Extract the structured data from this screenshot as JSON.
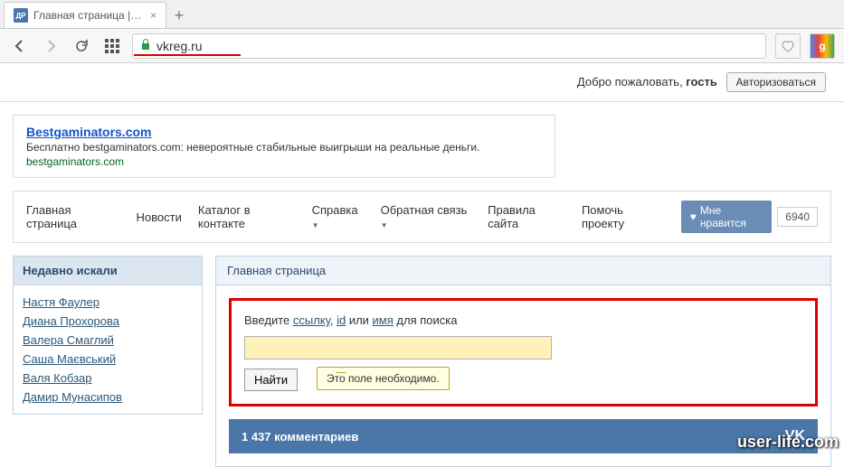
{
  "browser": {
    "tab_favicon": "ДР",
    "tab_title": "Главная страница | Дата р",
    "url": "vkreg.ru"
  },
  "welcome": {
    "text_prefix": "Добро пожаловать, ",
    "guest": "гость",
    "login_btn": "Авторизоваться"
  },
  "ad": {
    "title": "Bestgaminators.com",
    "desc": "Бесплатно bestgaminators.com: невероятные стабильные выигрыши на реальные деньги.",
    "url": "bestgaminators.com"
  },
  "nav": {
    "items": [
      "Главная страница",
      "Новости",
      "Каталог в контакте",
      "Справка",
      "Обратная связь",
      "Правила сайта",
      "Помочь проекту"
    ],
    "like_label": "Мне нравится",
    "like_count": "6940"
  },
  "sidebar": {
    "title": "Недавно искали",
    "items": [
      "Настя Фаулер",
      "Диана Прохорова",
      "Валера Смаглий",
      "Саша Маєвський",
      "Валя Кобзар",
      "Дамир Мунасипов"
    ]
  },
  "main": {
    "title": "Главная страница",
    "search": {
      "label_pre": "Введите ",
      "label_link1": "ссылку",
      "label_mid1": ", ",
      "label_link2": "id",
      "label_mid2": " или ",
      "label_link3": "имя",
      "label_post": " для поиска",
      "find_btn": "Найти",
      "tooltip": "Это поле необходимо."
    },
    "comments": "1 437 комментариев",
    "vk": "VK"
  },
  "watermark": "user-life.com"
}
